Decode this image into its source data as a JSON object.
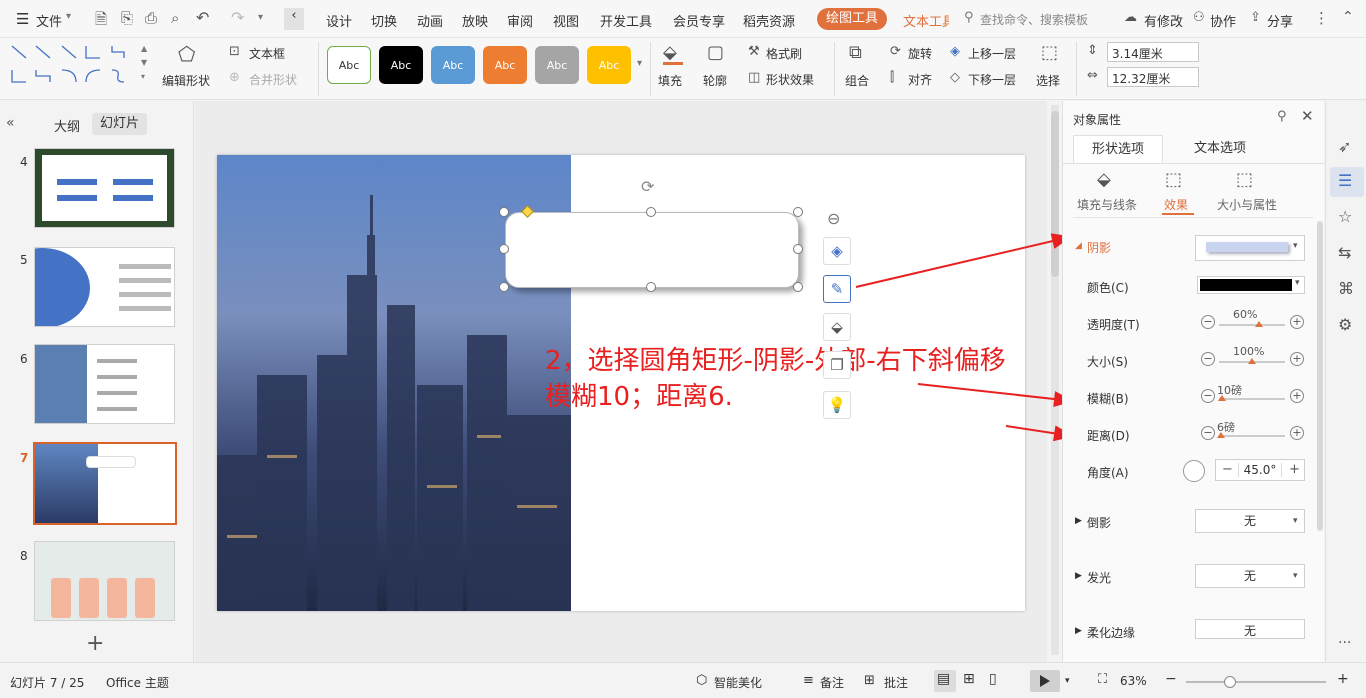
{
  "menubar": {
    "file": "文件",
    "tabs": [
      "设计",
      "切换",
      "动画",
      "放映",
      "审阅",
      "视图",
      "开发工具",
      "会员专享",
      "稻壳资源"
    ],
    "drawing_tools": "绘图工具",
    "text_tools": "文本工具",
    "search_placeholder": "查找命令、搜索模板",
    "has_changes": "有修改",
    "collaborate": "协作",
    "share": "分享"
  },
  "ribbon": {
    "edit_shape": "编辑形状",
    "text_box": "文本框",
    "merge_shape": "合并形状",
    "style_label": "Abc",
    "fill": "填充",
    "outline": "轮廓",
    "format_painter": "格式刷",
    "shape_effects": "形状效果",
    "group": "组合",
    "rotate": "旋转",
    "align": "对齐",
    "bring_forward": "上移一层",
    "send_backward": "下移一层",
    "select": "选择",
    "height": "3.14厘米",
    "width": "12.32厘米",
    "style_colors": [
      "#ffffff",
      "#000000",
      "#5b9bd5",
      "#ed7d31",
      "#a5a5a5",
      "#ffc000"
    ]
  },
  "left_panel": {
    "tab_outline": "大纲",
    "tab_slides": "幻灯片",
    "slides": [
      {
        "num": "4"
      },
      {
        "num": "5"
      },
      {
        "num": "6"
      },
      {
        "num": "7"
      },
      {
        "num": "8"
      }
    ],
    "add": "+"
  },
  "annotation": {
    "line1": "2，选择圆角矩形-阴影-外部-右下斜偏移",
    "line2": "模糊10；距离6."
  },
  "right_panel": {
    "title": "对象属性",
    "tab_shape": "形状选项",
    "tab_text": "文本选项",
    "sub_fill": "填充与线条",
    "sub_effects": "效果",
    "sub_size": "大小与属性",
    "shadow": "阴影",
    "color": "颜色(C)",
    "transparency": "透明度(T)",
    "transparency_val": "60%",
    "transparency_pct": 60,
    "size": "大小(S)",
    "size_val": "100%",
    "size_pct": 50,
    "blur": "模糊(B)",
    "blur_val": "10磅",
    "blur_pct": 5,
    "distance": "距离(D)",
    "distance_val": "6磅",
    "distance_pct": 3,
    "angle": "角度(A)",
    "angle_val": "45.0°",
    "reflection": "倒影",
    "glow": "发光",
    "soft_edges": "柔化边缘",
    "none": "无"
  },
  "statusbar": {
    "slide_info": "幻灯片 7 / 25",
    "theme": "Office 主题",
    "smart_beautify": "智能美化",
    "notes": "备注",
    "comments": "批注",
    "zoom": "63%"
  }
}
